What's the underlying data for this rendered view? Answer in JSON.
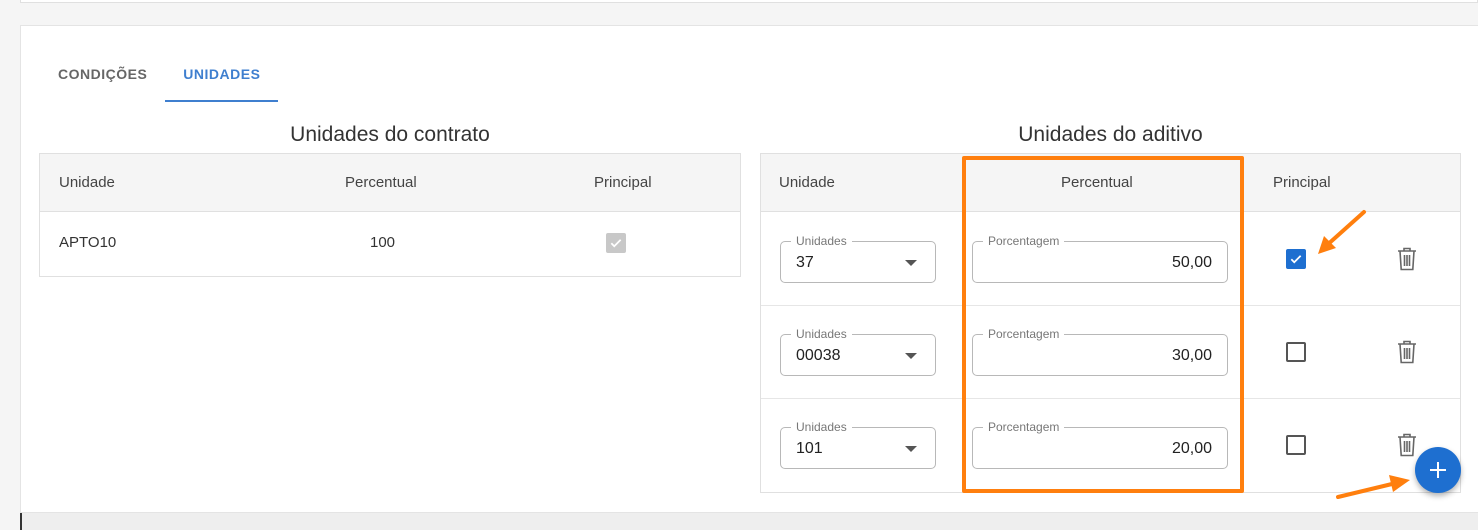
{
  "tabs": [
    {
      "label": "CONDIÇÕES",
      "active": false
    },
    {
      "label": "UNIDADES",
      "active": true
    }
  ],
  "contrato": {
    "title": "Unidades do contrato",
    "headers": {
      "unidade": "Unidade",
      "percentual": "Percentual",
      "principal": "Principal"
    },
    "rows": [
      {
        "unidade": "APTO10",
        "percentual": "100",
        "principal": true
      }
    ]
  },
  "aditivo": {
    "title": "Unidades do aditivo",
    "headers": {
      "unidade": "Unidade",
      "percentual": "Percentual",
      "principal": "Principal"
    },
    "rows": [
      {
        "unidade_label": "Unidades",
        "unidade": "37",
        "percentual_label": "Porcentagem",
        "percentual": "50,00",
        "principal": true
      },
      {
        "unidade_label": "Unidades",
        "unidade": "00038",
        "percentual_label": "Porcentagem",
        "percentual": "30,00",
        "principal": false
      },
      {
        "unidade_label": "Unidades",
        "unidade": "101",
        "percentual_label": "Porcentagem",
        "percentual": "20,00",
        "principal": false
      }
    ]
  },
  "colors": {
    "accent": "#1e6fd0",
    "tab_active": "#3f7fcf",
    "highlight": "#ff7f0e"
  },
  "icons": {
    "add": "plus-icon",
    "delete": "trash-icon",
    "dropdown": "caret-down-icon",
    "check": "check-icon"
  }
}
